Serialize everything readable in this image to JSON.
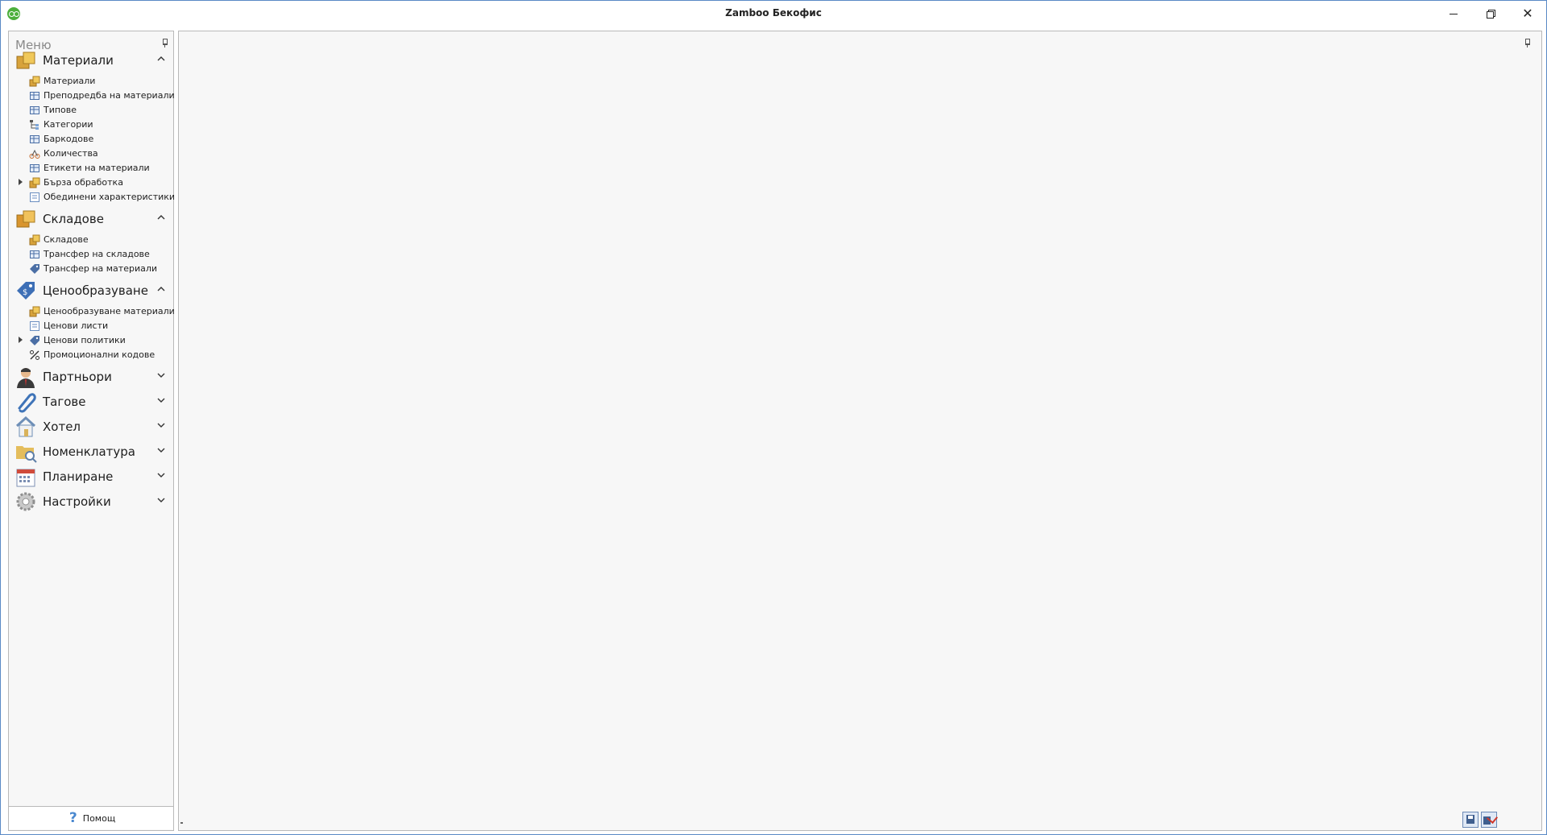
{
  "window": {
    "title": "Zamboo Бекофис",
    "app_icon": "zamboo-logo-icon",
    "controls": {
      "minimize": "minimize-icon",
      "restore": "restore-icon",
      "close": "close-icon",
      "close_glyph": "✕"
    }
  },
  "sidebar": {
    "title": "Меню",
    "pin_icon": "pin-icon",
    "groups": [
      {
        "label": "Материали",
        "icon": "materials-boxes-icon",
        "expanded": true,
        "items": [
          {
            "label": "Материали",
            "icon": "box-icon"
          },
          {
            "label": "Преподредба на материали",
            "icon": "reorder-icon"
          },
          {
            "label": "Типове",
            "icon": "types-icon"
          },
          {
            "label": "Категории",
            "icon": "category-tree-icon"
          },
          {
            "label": "Баркодове",
            "icon": "barcode-icon"
          },
          {
            "label": "Количества",
            "icon": "scale-icon"
          },
          {
            "label": "Етикети на материали",
            "icon": "label-grid-icon"
          },
          {
            "label": "Бърза обработка",
            "icon": "quick-process-icon",
            "has_children": true
          },
          {
            "label": "Обединени характеристики",
            "icon": "merged-features-icon"
          }
        ]
      },
      {
        "label": "Складове",
        "icon": "warehouses-icon",
        "expanded": true,
        "items": [
          {
            "label": "Складове",
            "icon": "warehouse-icon"
          },
          {
            "label": "Трансфер на складове",
            "icon": "warehouse-transfer-icon"
          },
          {
            "label": "Трансфер на материали",
            "icon": "material-transfer-icon"
          }
        ]
      },
      {
        "label": "Ценообразуване",
        "icon": "price-tag-icon",
        "expanded": true,
        "items": [
          {
            "label": "Ценообразуване материали",
            "icon": "material-pricing-icon"
          },
          {
            "label": "Ценови листи",
            "icon": "price-list-icon"
          },
          {
            "label": "Ценови политики",
            "icon": "price-policy-icon",
            "has_children": true
          },
          {
            "label": "Промоционални кодове",
            "icon": "percent-icon"
          }
        ]
      },
      {
        "label": "Партньори",
        "icon": "partner-person-icon",
        "expanded": false,
        "items": []
      },
      {
        "label": "Тагове",
        "icon": "paperclip-icon",
        "expanded": false,
        "items": []
      },
      {
        "label": "Хотел",
        "icon": "house-icon",
        "expanded": false,
        "items": []
      },
      {
        "label": "Номенклатура",
        "icon": "folder-search-icon",
        "expanded": false,
        "items": []
      },
      {
        "label": "Планиране",
        "icon": "calendar-icon",
        "expanded": false,
        "items": []
      },
      {
        "label": "Настройки",
        "icon": "gear-icon",
        "expanded": false,
        "items": []
      }
    ],
    "help": {
      "label": "Помощ",
      "icon": "question-icon",
      "glyph": "?"
    }
  },
  "main": {
    "pin_icon": "pin-icon",
    "tray": [
      {
        "icon": "save-icon"
      },
      {
        "icon": "save-all-icon"
      }
    ]
  }
}
